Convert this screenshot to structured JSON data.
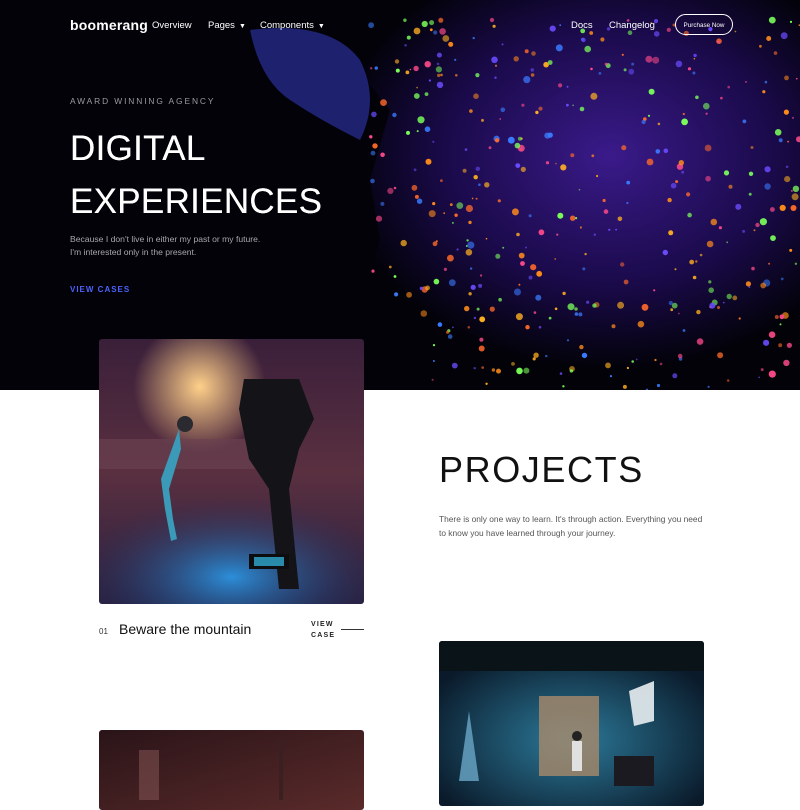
{
  "nav": {
    "brand": "boomerang",
    "links": [
      {
        "label": "Overview"
      },
      {
        "label": "Pages",
        "caret": "▼"
      },
      {
        "label": "Components",
        "caret": "▼"
      },
      {
        "label": "Docs"
      },
      {
        "label": "Changelog"
      }
    ],
    "cta": "Purchase Now"
  },
  "hero": {
    "eyebrow": "AWARD WINNING AGENCY",
    "title_lines": [
      "DIGITAL",
      "EXPERIENCES"
    ],
    "text_lines": [
      "Because I don't live in either my past or my future.",
      "I'm interested only in the present."
    ],
    "cta": "VIEW CASES"
  },
  "projects": {
    "title": "PROJECTS",
    "text_lines": [
      "There is only one way to learn. It's through action. Everything you need",
      "to know you have learned through your journey."
    ],
    "items": [
      {
        "number": "01",
        "name": "Beware the mountain",
        "cta_lines": [
          "VIEW",
          "CASE"
        ]
      }
    ]
  },
  "colors": {
    "hero_bg": "#020208",
    "accent": "#4d62ff",
    "heading": "#111111",
    "body_text": "#555555"
  }
}
